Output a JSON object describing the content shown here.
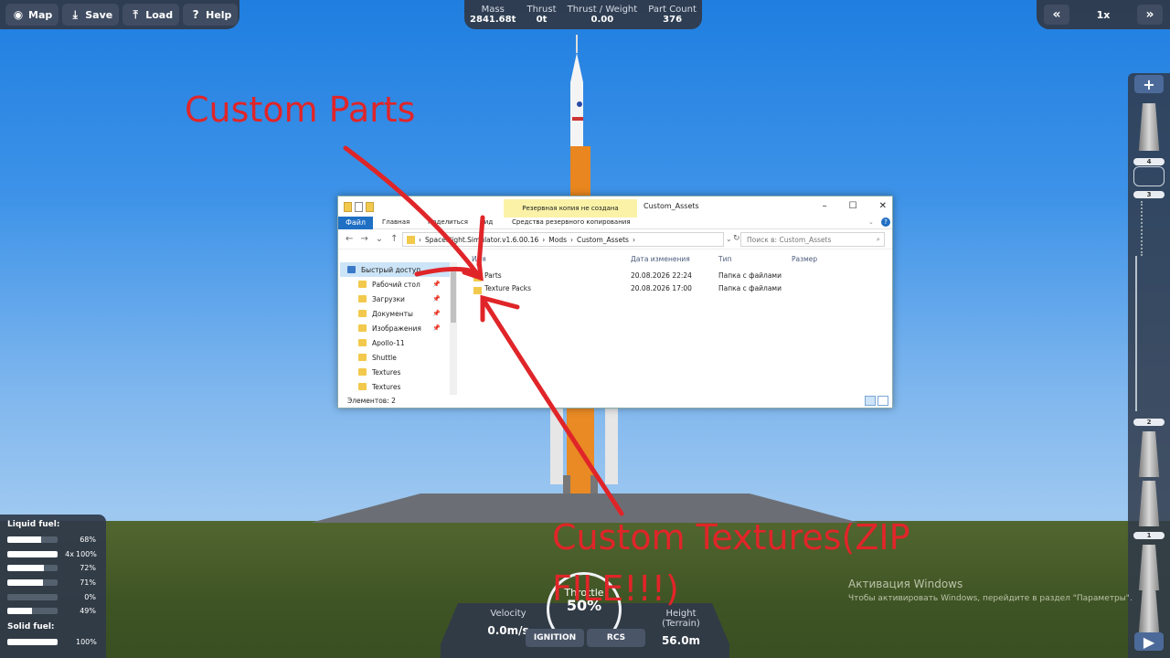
{
  "toolbar": {
    "map": "Map",
    "save": "Save",
    "load": "Load",
    "help": "Help"
  },
  "stats": [
    {
      "label": "Mass",
      "value": "2841.68t"
    },
    {
      "label": "Thrust",
      "value": "0t"
    },
    {
      "label": "Thrust / Weight",
      "value": "0.00"
    },
    {
      "label": "Part Count",
      "value": "376"
    }
  ],
  "timewarp": {
    "speed": "1x"
  },
  "staging": {
    "stages": [
      "4",
      "3",
      "2",
      "1"
    ]
  },
  "fuel": {
    "liquid_label": "Liquid fuel:",
    "solid_label": "Solid fuel:",
    "liquid": [
      {
        "multiplier": "",
        "percent": "68%",
        "fill": 0.68
      },
      {
        "multiplier": "4x",
        "percent": "100%",
        "fill": 1.0
      },
      {
        "multiplier": "",
        "percent": "72%",
        "fill": 0.72
      },
      {
        "multiplier": "",
        "percent": "71%",
        "fill": 0.71
      },
      {
        "multiplier": "",
        "percent": "0%",
        "fill": 0.0
      },
      {
        "multiplier": "",
        "percent": "49%",
        "fill": 0.49
      }
    ],
    "solid": [
      {
        "multiplier": "",
        "percent": "100%",
        "fill": 1.0
      }
    ]
  },
  "flight": {
    "velocity_label": "Velocity",
    "velocity": "0.0m/s",
    "height_label": "Height (Terrain)",
    "height": "56.0m",
    "throttle_label": "Throttle",
    "throttle": "50%",
    "ignition": "IGNITION",
    "rcs": "RCS"
  },
  "explorer": {
    "backup_warning": "Резервная копия не создана",
    "title": "Custom_Assets",
    "tabs": [
      "Файл",
      "Главная",
      "Поделиться",
      "Вид",
      "Средства резервного копирования"
    ],
    "path": [
      "SpaceFlight.Simulator.v1.6.00.16",
      "Mods",
      "Custom_Assets"
    ],
    "search_placeholder": "Поиск в: Custom_Assets",
    "nav": [
      {
        "label": "Быстрый доступ",
        "pinned": false
      },
      {
        "label": "Рабочий стол",
        "pinned": true
      },
      {
        "label": "Загрузки",
        "pinned": true
      },
      {
        "label": "Документы",
        "pinned": true
      },
      {
        "label": "Изображения",
        "pinned": true
      },
      {
        "label": "Apollo-11",
        "pinned": false
      },
      {
        "label": "Shuttle",
        "pinned": false
      },
      {
        "label": "Textures",
        "pinned": false
      },
      {
        "label": "Textures",
        "pinned": false
      }
    ],
    "columns": [
      "Имя",
      "Дата изменения",
      "Тип",
      "Размер"
    ],
    "files": [
      {
        "name": "Parts",
        "date": "20.08.2026 22:24",
        "type": "Папка с файлами",
        "size": ""
      },
      {
        "name": "Texture Packs",
        "date": "20.08.2026 17:00",
        "type": "Папка с файлами",
        "size": ""
      }
    ],
    "status": "Элементов: 2"
  },
  "annotations": {
    "parts": "Custom Parts",
    "textures_line1": "Custom Textures(ZIP",
    "textures_line2": "FILE!!!)",
    "color": "#e02529"
  },
  "activation": {
    "title": "Активация Windows",
    "subtitle": "Чтобы активировать Windows, перейдите в раздел \"Параметры\"."
  }
}
